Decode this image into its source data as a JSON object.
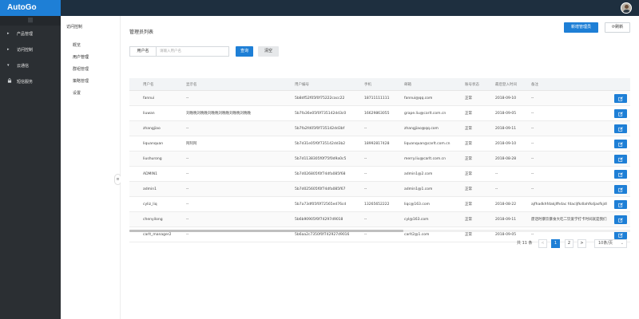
{
  "app": {
    "title": "AutoGo"
  },
  "sidebar": {
    "collapse_glyph": "|||",
    "items": [
      {
        "label": "产品管理",
        "icon": "caret-right-icon"
      },
      {
        "label": "访问控制",
        "icon": "caret-right-icon"
      },
      {
        "label": "云通信",
        "icon": "caret-down-icon"
      },
      {
        "label": "短信服务",
        "icon": "lock-icon"
      }
    ]
  },
  "subnav": {
    "title": "访问控制",
    "items": [
      "概览",
      "用户管理",
      "群组管理",
      "策略管理",
      "设置"
    ],
    "active_index": 1
  },
  "main": {
    "title": "管理员列表",
    "new_button": "新增管理员",
    "refresh_button": "刷新",
    "search": {
      "label": "用户名",
      "placeholder": "请输入用户名",
      "value": ""
    },
    "query_button": "查询",
    "clear_button": "清空"
  },
  "table": {
    "columns": [
      "用户名",
      "显示名",
      "用户编号",
      "手机",
      "邮箱",
      "账号状态",
      "最后登入时间",
      "备注"
    ],
    "rows": [
      [
        "fannui",
        "--",
        "5b8df52f05f0f75222cacc22",
        "18711111111",
        "fannui@qq.com",
        "正常",
        "2018-09-10",
        "--"
      ],
      [
        "liuwan",
        "刘晚晚刘晚晚刘晚晚刘晚晚刘晚晚刘晚晚",
        "5b7fa36e05f0f735142dd3c0",
        "16629863055",
        "grape.liu@carlt.com.cn",
        "正常",
        "2018-09-05",
        "--"
      ],
      [
        "zhangjiao",
        "--",
        "5b7fa2fd05f0f735142dd3bf",
        "--",
        "zhangjiao@qq.com",
        "正常",
        "2018-09-11",
        "--"
      ],
      [
        "liquanquan",
        "阿阿阿",
        "5b7d31e05f0f735142dd3b2",
        "18992817428",
        "liquanquan@carlt.com.cn",
        "正常",
        "2018-09-10",
        "--"
      ],
      [
        "liushurong",
        "--",
        "5b7d1138305f0f75f0d9a0c5",
        "--",
        "merry.liu@carlt.com.cn",
        "正常",
        "2018-08-28",
        "--"
      ],
      [
        "ADMIN1",
        "--",
        "5b7d026805f0f74dfa085f68",
        "--",
        "admin1@2.com",
        "正常",
        "--",
        "--"
      ],
      [
        "admin1",
        "--",
        "5b7d025605f0f74dfa085f67",
        "--",
        "admin1@1.com",
        "正常",
        "--",
        "--"
      ],
      [
        "cyliz_liq",
        "--",
        "5b7a73df05f0f72565ed76cd",
        "13265652222",
        "liqc@163.com",
        "正常",
        "2018-08-22",
        "ajfhadkhfdakjlfhdac fdacljfkdlahfkdjasfkjdl"
      ],
      [
        "chenyilong",
        "--",
        "5b6b90905f0f74297d9018",
        "--",
        "cyl@163.com",
        "正常",
        "2018-09-11",
        "废话时暴饮暴食大吃二饮爱学打卡时间就是我们"
      ],
      [
        "carlt_manager2",
        "--",
        "5b6aa2c7350f0f742927d9016",
        "--",
        "carlt2@1.com",
        "正常",
        "2018-09-05",
        "--"
      ]
    ]
  },
  "pagination": {
    "total": "共 11 条",
    "prev": "<",
    "pages": [
      "1",
      "2"
    ],
    "next": ">",
    "page_size": "10条/页",
    "current_page": 1
  },
  "colors": {
    "brand": "#1e7fd6",
    "topbar": "#1e2f3f",
    "sidebar": "#2b2f33"
  }
}
